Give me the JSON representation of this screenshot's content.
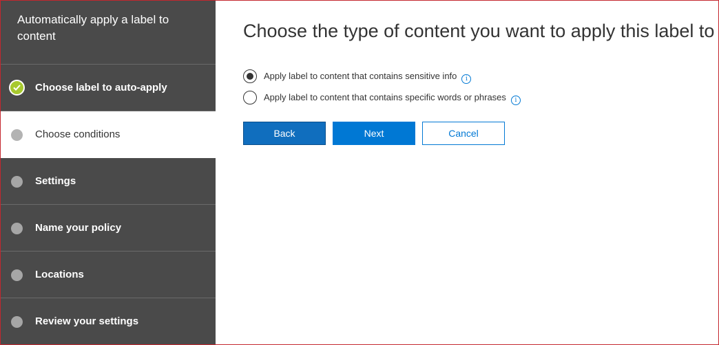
{
  "sidebar": {
    "title": "Automatically apply a label to content",
    "steps": [
      {
        "label": "Choose label to auto-apply",
        "state": "completed"
      },
      {
        "label": "Choose conditions",
        "state": "current"
      },
      {
        "label": "Settings",
        "state": "pending"
      },
      {
        "label": "Name your policy",
        "state": "pending"
      },
      {
        "label": "Locations",
        "state": "pending"
      },
      {
        "label": "Review your settings",
        "state": "pending"
      }
    ]
  },
  "main": {
    "heading": "Choose the type of content you want to apply this label to",
    "options": [
      {
        "label": "Apply label to content that contains sensitive info",
        "selected": true,
        "info_icon": "info-icon"
      },
      {
        "label": "Apply label to content that contains specific words or phrases",
        "selected": false,
        "info_icon": "info-icon"
      }
    ],
    "buttons": {
      "back": "Back",
      "next": "Next",
      "cancel": "Cancel"
    },
    "info_glyph": "i"
  },
  "colors": {
    "sidebar_bg": "#4a4a4a",
    "accent": "#0078d4",
    "completed_check": "#a7c92e",
    "frame_border": "#c4262e"
  }
}
